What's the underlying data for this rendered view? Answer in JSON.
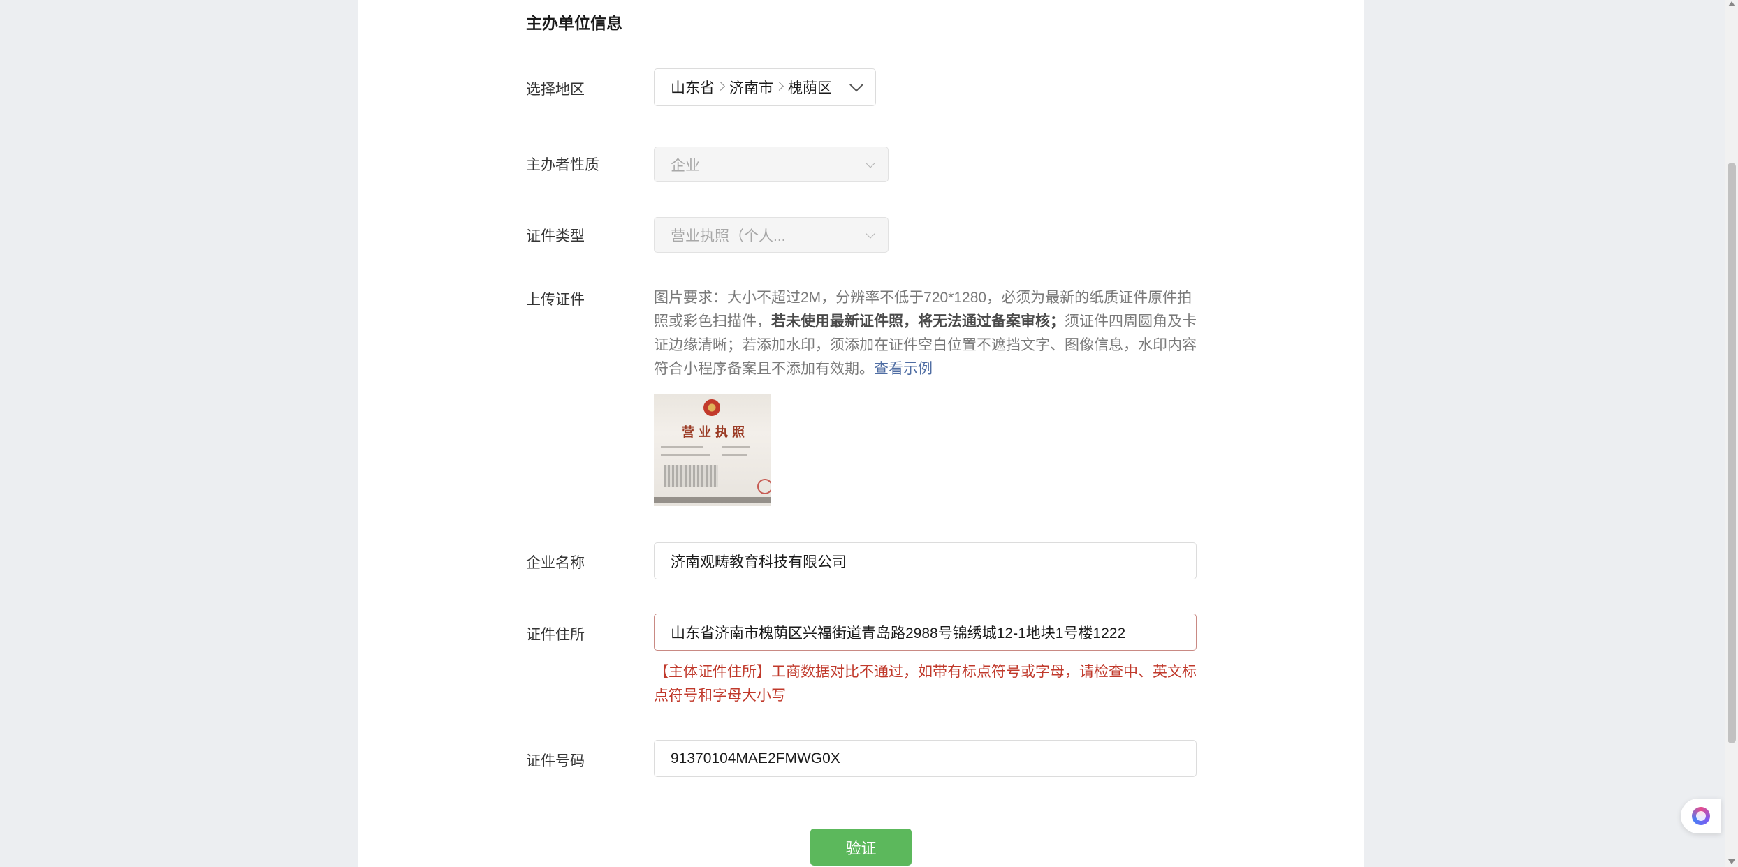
{
  "section": {
    "title": "主办单位信息"
  },
  "region": {
    "label": "选择地区",
    "province": "山东省",
    "city": "济南市",
    "district": "槐荫区"
  },
  "sponsor_type": {
    "label": "主办者性质",
    "value": "企业"
  },
  "cert_type": {
    "label": "证件类型",
    "value": "营业执照（个人..."
  },
  "upload": {
    "label": "上传证件",
    "desc_part1": "图片要求：大小不超过2M，分辨率不低于720*1280，必须为最新的纸质证件原件拍照或彩色扫描件，",
    "desc_bold": "若未使用最新证件照，将无法通过备案审核；",
    "desc_part2": "须证件四周圆角及卡证边缘清晰；若添加水印，须添加在证件空白位置不遮挡文字、图像信息，水印内容符合小程序备案且不添加有效期。",
    "example_link": "查看示例",
    "thumb_title": "营业执照"
  },
  "company_name": {
    "label": "企业名称",
    "value": "济南观畴教育科技有限公司"
  },
  "cert_address": {
    "label": "证件住所",
    "value": "山东省济南市槐荫区兴福街道青岛路2988号锦绣城12-1地块1号楼1222",
    "error": "【主体证件住所】工商数据对比不通过，如带有标点符号或字母，请检查中、英文标点符号和字母大小写"
  },
  "cert_number": {
    "label": "证件号码",
    "value": "91370104MAE2FMWG0X"
  },
  "verify_button": "验证",
  "colors": {
    "primary_button": "#5cb85c",
    "error": "#c0392b",
    "link": "#4f6da3"
  }
}
